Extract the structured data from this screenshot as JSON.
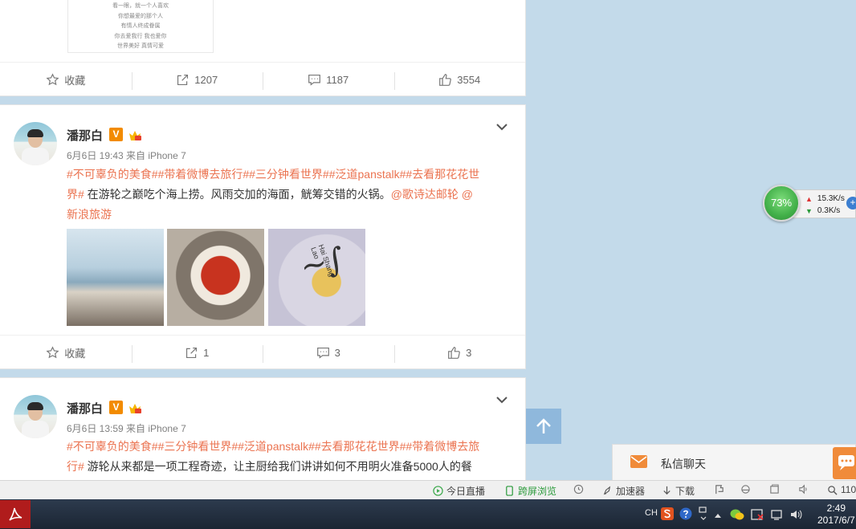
{
  "feed": {
    "post1": {
      "image_lines": [
        "看一眼，就一个人喜欢",
        "你想最爱的那个人",
        "有情人终成眷属",
        "你去爱我行 我也爱你",
        "世界美好 真情可爱"
      ],
      "actions": {
        "favorite": "收藏",
        "repost": "1207",
        "comment": "1187",
        "like": "3554"
      }
    },
    "post2": {
      "username": "潘那白",
      "verified": "V",
      "meta": "6月6日 19:43 来自 iPhone 7",
      "topics_line1": "#不可辜负的美食##带着微博去旅行##三分钟看世界##泛道panstalk##去看那花花世",
      "topics_line2": "界#",
      "text_line2": " 在游轮之巅吃个海上捞。风雨交加的海面，觥筹交错的火锅。",
      "mention1": "@歌诗达邮轮",
      "mention2": "@",
      "text_line3": "新浪旅游",
      "photo3_brand": "Hai Shang Lao",
      "actions": {
        "favorite": "收藏",
        "repost": "1",
        "comment": "3",
        "like": "3"
      }
    },
    "post3": {
      "username": "潘那白",
      "verified": "V",
      "meta": "6月6日 13:59 来自 iPhone 7",
      "topics_line1": "#不可辜负的美食##三分钟看世界##泛道panstalk##去看那花花世界##带着微博去旅",
      "topics_line2": "行#",
      "text_line2": " 游轮从来都是一项工程奇迹，让主厨给我们讲讲如何不用明火准备5000人的餐"
    }
  },
  "widget": {
    "cpu": "73%",
    "upload": "15.3K/s",
    "download": "0.3K/s",
    "plus": "+"
  },
  "chat": {
    "label": "私信聊天"
  },
  "status_bar": {
    "live": "今日直播",
    "cross_screen": "跨屏浏览",
    "accelerator": "加速器",
    "download": "下载",
    "zoom": "110"
  },
  "taskbar": {
    "lang": "CH",
    "time": "2:49",
    "date": "2017/6/7"
  },
  "colors": {
    "topic": "#eb7350",
    "accent_orange": "#f08b3a",
    "background": "#c3daea"
  }
}
